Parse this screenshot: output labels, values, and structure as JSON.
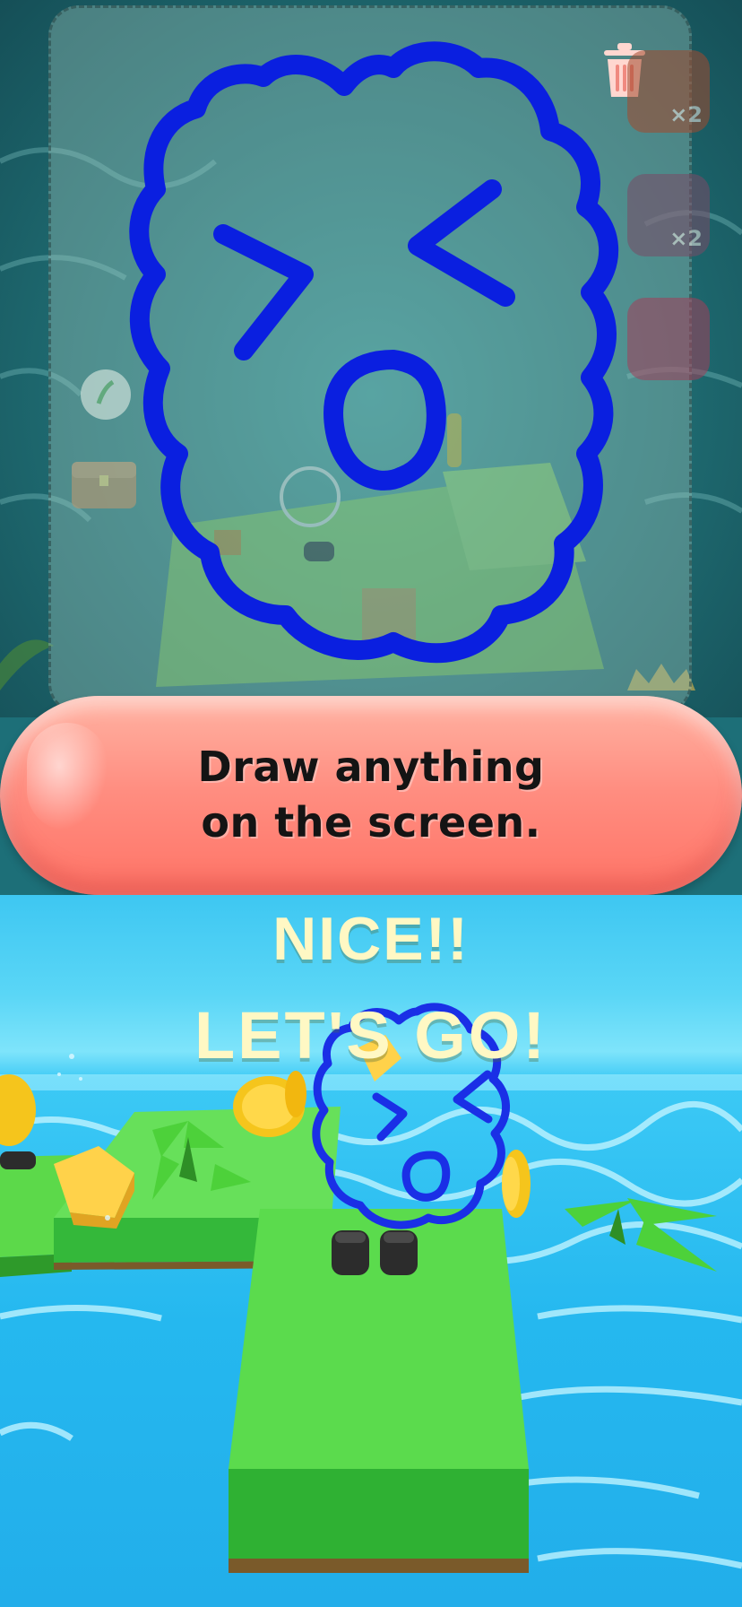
{
  "banner": {
    "line1": "Draw anything",
    "line2": "on the screen."
  },
  "feedback": {
    "nice": "NICE!!",
    "lets_go": "LET'S GO!"
  },
  "side_buttons": [
    {
      "icon": "ink-plant-icon",
      "badge": "×2"
    },
    {
      "icon": "ink-plant-icon",
      "badge": "×2"
    },
    {
      "icon": "ink-plant-icon",
      "badge": ""
    }
  ],
  "colors": {
    "drawing_stroke": "#0a1fe0",
    "banner": "#ff8d80",
    "feedback_text": "#fff8c4",
    "platform": "#58d948",
    "water": "#29b6ee"
  }
}
